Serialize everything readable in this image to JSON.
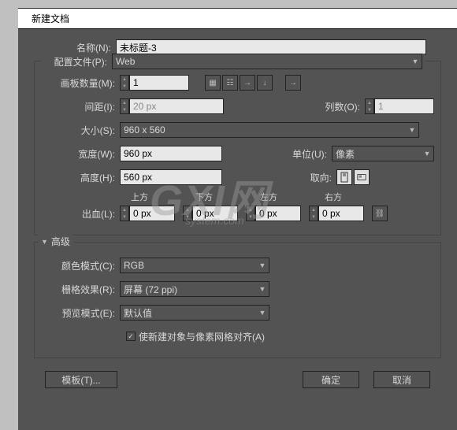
{
  "title": "新建文档",
  "labels": {
    "name": "名称(N):",
    "profile": "配置文件(P):",
    "artboards": "画板数量(M):",
    "spacing": "间距(I):",
    "cols": "列数(O):",
    "size": "大小(S):",
    "width": "宽度(W):",
    "height": "高度(H):",
    "units": "单位(U):",
    "orient": "取向:",
    "bleed": "出血(L):",
    "top": "上方",
    "bottom": "下方",
    "left": "左方",
    "right": "右方",
    "advanced": "高级",
    "colormode": "颜色模式(C):",
    "raster": "栅格效果(R):",
    "preview": "预览模式(E):",
    "align": "使新建对象与像素网格对齐(A)",
    "template": "模板(T)...",
    "ok": "确定",
    "cancel": "取消"
  },
  "values": {
    "name": "未标题-3",
    "profile": "Web",
    "artboards": "1",
    "spacing": "20 px",
    "cols": "1",
    "size": "960 x 560",
    "width": "960 px",
    "height": "560 px",
    "units": "像素",
    "bleed_top": "0 px",
    "bleed_bottom": "0 px",
    "bleed_left": "0 px",
    "bleed_right": "0 px",
    "colormode": "RGB",
    "raster": "屏幕 (72 ppi)",
    "preview": "默认值",
    "align_checked": "✓"
  }
}
